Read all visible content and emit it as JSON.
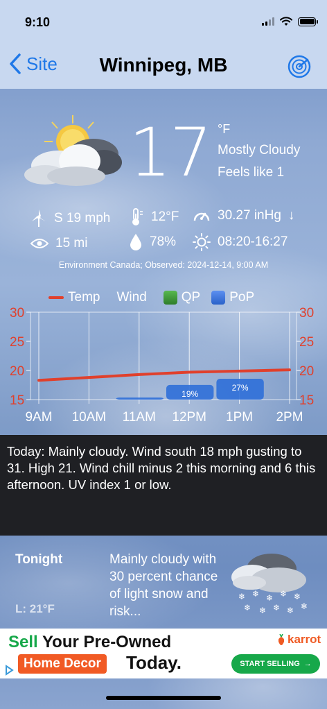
{
  "status": {
    "time": "9:10"
  },
  "nav": {
    "back_label": "Site",
    "title": "Winnipeg, MB"
  },
  "current": {
    "temp": "17",
    "unit": "°F",
    "condition": "Mostly Cloudy",
    "feels_like": "Feels like 1",
    "wind": "S 19 mph",
    "dewpoint": "12°F",
    "pressure": "30.27 inHg",
    "pressure_trend": "↓",
    "visibility": "15 mi",
    "humidity": "78%",
    "sun": "08:20-16:27",
    "observed": "Environment Canada; Observed: 2024-12-14, 9:00 AM"
  },
  "legend": {
    "temp": "Temp",
    "wind": "Wind",
    "qp": "QP",
    "pop": "PoP"
  },
  "colors": {
    "temp_line": "#e0402c",
    "qp": "#3e9a3a",
    "pop": "#2f6fd8",
    "axis_label": "#e0402c"
  },
  "chart_data": {
    "type": "bar",
    "categories": [
      "9AM",
      "10AM",
      "11AM",
      "12PM",
      "1PM",
      "2PM"
    ],
    "ylim": [
      15,
      30
    ],
    "yticks": [
      "30",
      "25",
      "20",
      "15"
    ],
    "series": [
      {
        "name": "Temp",
        "type": "line",
        "values": [
          18.3,
          18.8,
          19.3,
          19.7,
          19.9,
          20.1
        ]
      },
      {
        "name": "PoP",
        "type": "bar",
        "values": [
          0,
          0,
          2,
          19,
          27,
          0
        ],
        "labels": [
          "",
          "",
          "",
          "19%",
          "27%",
          ""
        ]
      }
    ]
  },
  "today": {
    "text": "Today:  Mainly cloudy. Wind south 18 mph gusting to 31. High 21. Wind chill minus 2 this morning and 6 this afternoon. UV index 1 or low."
  },
  "tonight": {
    "label": "Tonight",
    "low": "L: 21°F",
    "text": "Mainly cloudy with 30 percent chance of light snow and risk..."
  },
  "ad": {
    "line1_green": "Sell",
    "line1_rest": " Your Pre-Owned",
    "pill": "Home Decor",
    "today": "Today.",
    "brand": "karrot",
    "cta": "START SELLING"
  }
}
